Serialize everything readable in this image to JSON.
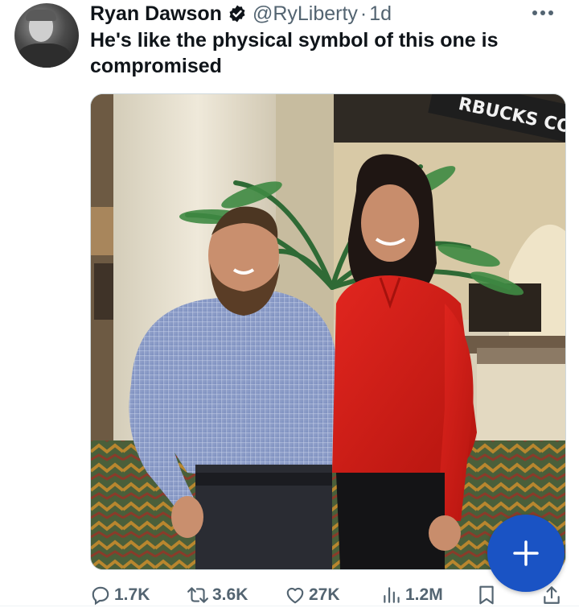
{
  "tweet": {
    "author_name": "Ryan Dawson",
    "handle": "@RyLiberty",
    "separator": "·",
    "age": "1d",
    "text": "He's like the physical symbol of this one is compromised",
    "photo_sign_text": "RBUCKS CO"
  },
  "actions": {
    "replies": "1.7K",
    "retweets": "3.6K",
    "likes": "27K",
    "views": "1.2M"
  },
  "icons": {
    "verified": "verified-badge-icon",
    "more": "more-dots-icon",
    "reply": "reply-bubble-icon",
    "retweet": "retweet-icon",
    "like": "heart-icon",
    "views": "views-bars-icon",
    "bookmark": "bookmark-icon",
    "share": "share-icon",
    "compose": "plus-icon"
  },
  "colors": {
    "accent_blue": "#1a53c4",
    "verified_blue": "#1d9bf0",
    "secondary_text": "#536471"
  }
}
